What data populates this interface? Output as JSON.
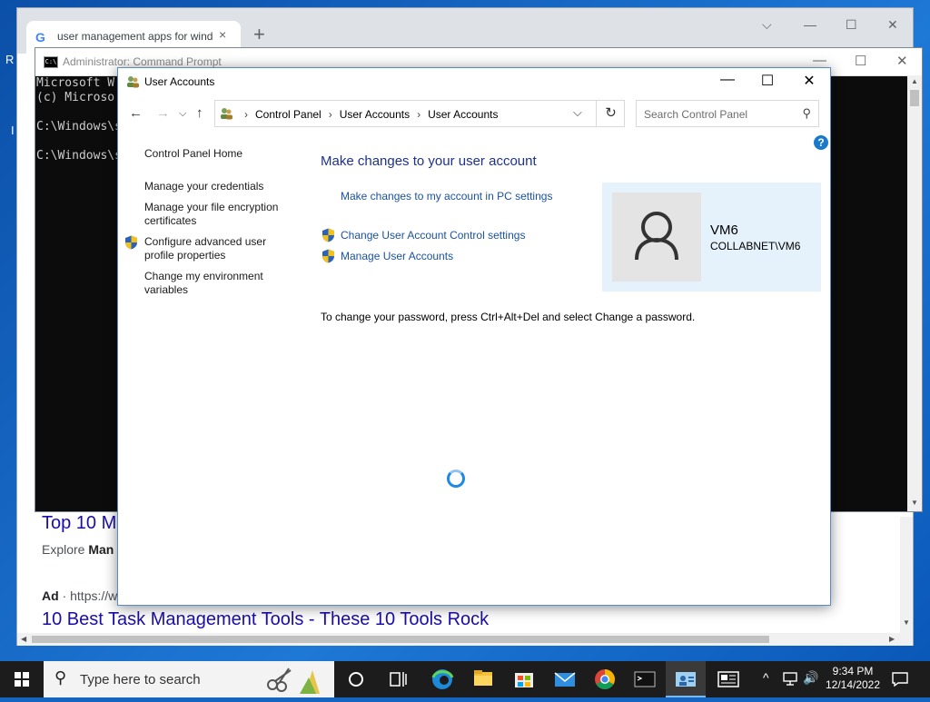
{
  "desktop": {
    "left_char": "R",
    "left_char2": "I"
  },
  "browser": {
    "tab_title": "user management apps for windows",
    "tab_close": "×",
    "new_tab": "+",
    "ctrl_chevron": "⌵",
    "ctrl_min": "—",
    "ctrl_max": "☐",
    "ctrl_close": "✕",
    "result1_title": "Top 10 M",
    "result1_snippet_prefix": "Explore ",
    "result1_snippet_bold": "Man",
    "ad_label": "Ad",
    "ad_sep": "·",
    "ad_url": "https://w",
    "result2_title": "10 Best Task Management Tools - These 10 Tools Rock"
  },
  "cmd": {
    "title": "Administrator: Command Prompt",
    "lines": [
      "Microsoft W",
      "(c) Microso",
      "",
      "C:\\Windows\\s",
      "",
      "C:\\Windows\\s"
    ],
    "ctrl_min": "—",
    "ctrl_max": "☐",
    "ctrl_close": "✕"
  },
  "user_accounts": {
    "title": "User Accounts",
    "ctrl_min": "—",
    "ctrl_max": "☐",
    "ctrl_close": "✕",
    "nav": {
      "back": "←",
      "forward": "→",
      "recent": "⌵",
      "up": "↑"
    },
    "breadcrumbs": [
      "Control Panel",
      "User Accounts",
      "User Accounts"
    ],
    "breadcrumb_sep": "›",
    "address_dropdown": "⌵",
    "refresh": "↻",
    "search_placeholder": "Search Control Panel",
    "search_icon": "⚲",
    "help": "?",
    "sidebar": {
      "home": "Control Panel Home",
      "credentials": "Manage your credentials",
      "encryption_1": "Manage your file encryption",
      "encryption_2": "certificates",
      "profile_1": "Configure advanced user",
      "profile_2": "profile properties",
      "env_1": "Change my environment",
      "env_2": "variables"
    },
    "main_title": "Make changes to your user account",
    "links": {
      "pc_settings": "Make changes to my account in PC settings",
      "uac": "Change User Account Control settings",
      "manage": "Manage User Accounts"
    },
    "account": {
      "name": "VM6",
      "domain": "COLLABNET\\VM6"
    },
    "password_note": "To change your password, press Ctrl+Alt+Del and select Change a password."
  },
  "taskbar": {
    "search_placeholder": "Type here to search",
    "time": "9:34 PM",
    "date": "12/14/2022",
    "tray_chevron": "^",
    "tray_volume": "🔊"
  },
  "colors": {
    "accent": "#1979ca",
    "link": "#1a52a0",
    "title_blue": "#1e3287",
    "account_bg": "#e5f1fb",
    "taskbar": "#1c1c1c"
  }
}
